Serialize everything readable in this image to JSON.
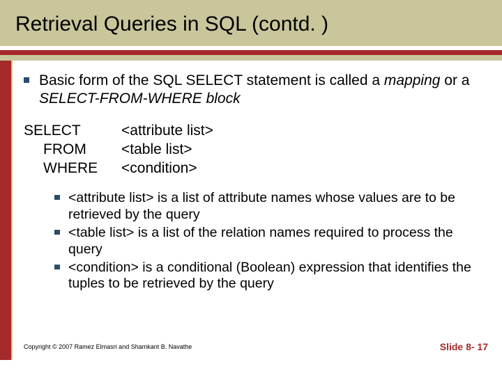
{
  "title": "Retrieval Queries in SQL (contd. )",
  "main": {
    "pre": "Basic form of the SQL SELECT statement is called a ",
    "em1": "mapping",
    "mid": " or a ",
    "em2": "SELECT-FROM-WHERE block"
  },
  "syntax": {
    "select": {
      "kw": "SELECT",
      "ph": "<attribute list>"
    },
    "from": {
      "kw": "FROM",
      "ph": "<table list>"
    },
    "where": {
      "kw": "WHERE",
      "ph": "<condition>"
    }
  },
  "subs": [
    "<attribute list> is a list of attribute names whose values are to be retrieved by the query",
    "<table list> is a list of the relation names required to process the query",
    "<condition> is a conditional (Boolean) expression that identifies the tuples to be retrieved by the query"
  ],
  "footer": {
    "copyright": "Copyright © 2007 Ramez Elmasri and Shamkant B. Navathe",
    "slide": "Slide 8- 17"
  }
}
